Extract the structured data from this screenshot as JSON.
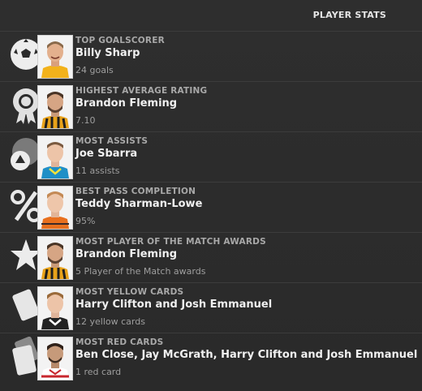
{
  "header": {
    "title": "PLAYER STATS"
  },
  "stats": [
    {
      "icon": "football-icon",
      "label": "TOP GOALSCORER",
      "name": "Billy Sharp",
      "value": "24 goals",
      "kit": "#f2b21b"
    },
    {
      "icon": "rating-rosette-icon",
      "label": "HIGHEST AVERAGE RATING",
      "name": "Brandon Fleming",
      "value": "7.10",
      "kit": "#e8a21a"
    },
    {
      "icon": "assist-triangle-icon",
      "label": "MOST ASSISTS",
      "name": "Joe Sbarra",
      "value": "11 assists",
      "kit": "#1f8fc7"
    },
    {
      "icon": "percent-icon",
      "label": "BEST PASS COMPLETION",
      "name": "Teddy Sharman-Lowe",
      "value": "95%",
      "kit": "#e8701e"
    },
    {
      "icon": "star-icon",
      "label": "MOST PLAYER OF THE MATCH AWARDS",
      "name": "Brandon Fleming",
      "value": "5 Player of the Match awards",
      "kit": "#e8a21a"
    },
    {
      "icon": "yellow-card-icon",
      "label": "MOST YELLOW CARDS",
      "name": "Harry Clifton and Josh Emmanuel",
      "value": "12 yellow cards",
      "kit": "#222222"
    },
    {
      "icon": "red-card-icon",
      "label": "MOST RED CARDS",
      "name": "Ben Close, Jay McGrath, Harry Clifton and Josh Emmanuel",
      "value": "1 red card",
      "kit": "#c8272e"
    }
  ]
}
